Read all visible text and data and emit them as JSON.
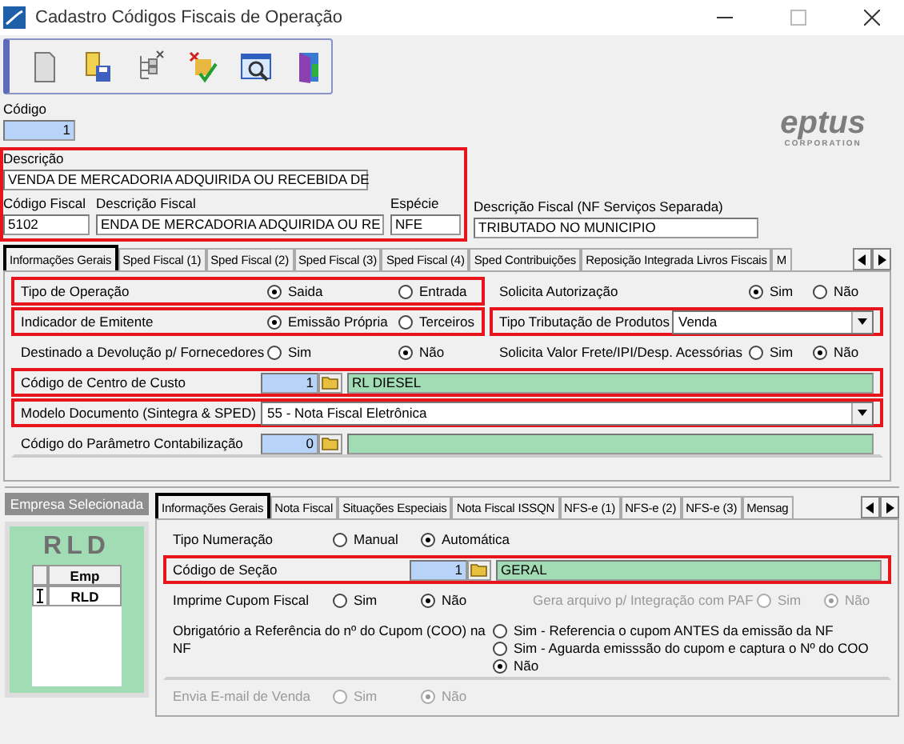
{
  "window": {
    "title": "Cadastro Códigos Fiscais de Operação"
  },
  "header": {
    "code": {
      "label": "Código",
      "value": "1"
    },
    "highlighted": true,
    "description": {
      "label": "Descrição",
      "value": "VENDA DE MERCADORIA ADQUIRIDA OU RECEBIDA DE"
    },
    "fields": [
      {
        "label": "Código Fiscal",
        "value": "5102"
      },
      {
        "label": "Descrição Fiscal",
        "value": "ENDA DE MERCADORIA ADQUIRIDA OU RE"
      },
      {
        "label": "Espécie",
        "value": "NFE"
      }
    ],
    "service_field": {
      "label": "Descrição Fiscal (NF Serviços Separada)",
      "value": "TRIBUTADO NO MUNICIPIO"
    }
  },
  "logo": {
    "name": "eptus",
    "tagline": "CORPORATION"
  },
  "main_tabs": [
    {
      "label": "Informações Gerais",
      "selected": true
    },
    {
      "label": "Sped Fiscal (1)",
      "selected": false
    },
    {
      "label": "Sped Fiscal (2)",
      "selected": false
    },
    {
      "label": "Sped Fiscal (3)",
      "selected": false
    },
    {
      "label": "Sped Fiscal (4)",
      "selected": false
    },
    {
      "label": "Sped Contribuições",
      "selected": false
    },
    {
      "label": "Reposição Integrada Livros Fiscais",
      "selected": false
    },
    {
      "label": "M",
      "selected": false
    }
  ],
  "main_panel": {
    "rows": [
      {
        "kind": "split",
        "left": {
          "kind": "radio",
          "label": "Tipo de Operação",
          "highlighted": true,
          "disabled": false,
          "options": [
            {
              "label": "Saida",
              "selected": true
            },
            {
              "label": "Entrada",
              "selected": false
            }
          ]
        },
        "right": {
          "kind": "radio",
          "label": "Solicita Autorização",
          "highlighted": false,
          "disabled": false,
          "options": [
            {
              "label": "Sim",
              "selected": true
            },
            {
              "label": "Não",
              "selected": false
            }
          ]
        }
      },
      {
        "kind": "split",
        "left": {
          "kind": "radio",
          "label": "Indicador de Emitente",
          "highlighted": true,
          "disabled": false,
          "options": [
            {
              "label": "Emissão Própria",
              "selected": true
            },
            {
              "label": "Terceiros",
              "selected": false
            }
          ]
        },
        "right": {
          "kind": "select",
          "label": "Tipo Tributação de Produtos",
          "highlighted": true,
          "disabled": false,
          "value": "Venda"
        }
      },
      {
        "kind": "split",
        "left": {
          "kind": "radio",
          "label": "Destinado a Devolução p/ Fornecedores",
          "highlighted": false,
          "disabled": false,
          "options": [
            {
              "label": "Sim",
              "selected": false
            },
            {
              "label": "Não",
              "selected": true
            }
          ]
        },
        "right": {
          "kind": "radio",
          "label": "Solicita Valor Frete/IPI/Desp. Acessórias",
          "highlighted": false,
          "disabled": false,
          "options": [
            {
              "label": "Sim",
              "selected": false
            },
            {
              "label": "Não",
              "selected": true
            }
          ]
        }
      },
      {
        "kind": "lookup",
        "label": "Código de Centro de Custo",
        "highlighted": true,
        "code": "1",
        "description": "RL DIESEL"
      },
      {
        "kind": "select",
        "label": "Modelo Documento (Sintegra & SPED)",
        "highlighted": true,
        "value": "55 - Nota Fiscal Eletrônica"
      },
      {
        "kind": "lookup",
        "label": "Código do Parâmetro Contabilização",
        "highlighted": false,
        "code": "0"
      }
    ]
  },
  "company_panel": {
    "title": "Empresa Selecionada",
    "logo": "RLD",
    "grid": {
      "column": "Emp",
      "rows": [
        "RLD"
      ]
    }
  },
  "detail_tabs": [
    {
      "label": "Informações Gerais",
      "selected": true
    },
    {
      "label": "Nota Fiscal",
      "selected": false
    },
    {
      "label": "Situações Especiais",
      "selected": false
    },
    {
      "label": "Nota Fiscal ISSQN",
      "selected": false
    },
    {
      "label": "NFS-e (1)",
      "selected": false
    },
    {
      "label": "NFS-e (2)",
      "selected": false
    },
    {
      "label": "NFS-e (3)",
      "selected": false
    },
    {
      "label": "Mensag",
      "selected": false
    }
  ],
  "detail_panel": {
    "rows": [
      {
        "kind": "radio",
        "label": "Tipo Numeração",
        "highlighted": false,
        "disabled": false,
        "options": [
          {
            "label": "Manual",
            "selected": false
          },
          {
            "label": "Automática",
            "selected": true
          }
        ]
      },
      {
        "kind": "lookup",
        "label": "Código de Seção",
        "highlighted": true,
        "code": "1",
        "description": "GERAL"
      },
      {
        "kind": "split",
        "left": {
          "kind": "radio",
          "label": "Imprime Cupom Fiscal",
          "highlighted": false,
          "disabled": false,
          "options": [
            {
              "label": "Sim",
              "selected": false
            },
            {
              "label": "Não",
              "selected": true
            }
          ]
        },
        "right": {
          "kind": "radio",
          "label": "Gera arquivo p/ Integração com PAF",
          "highlighted": false,
          "disabled": true,
          "options": [
            {
              "label": "Sim",
              "selected": false
            },
            {
              "label": "Não",
              "selected": true
            }
          ]
        }
      },
      {
        "kind": "stack",
        "label": "Obrigatório a Referência do nº do Cupom (COO) na NF",
        "highlighted": false,
        "disabled": false,
        "options": [
          {
            "label": "Sim - Referencia o cupom ANTES da emissão da NF",
            "selected": false
          },
          {
            "label": "Sim - Aguarda emisssão do cupom e captura o Nº do COO",
            "selected": false
          },
          {
            "label": "Não",
            "selected": true
          }
        ]
      },
      {
        "kind": "radio",
        "label": "Envia E-mail de Venda",
        "highlighted": false,
        "disabled": true,
        "options": [
          {
            "label": "Sim",
            "selected": false
          },
          {
            "label": "Não",
            "selected": true
          }
        ]
      }
    ]
  }
}
